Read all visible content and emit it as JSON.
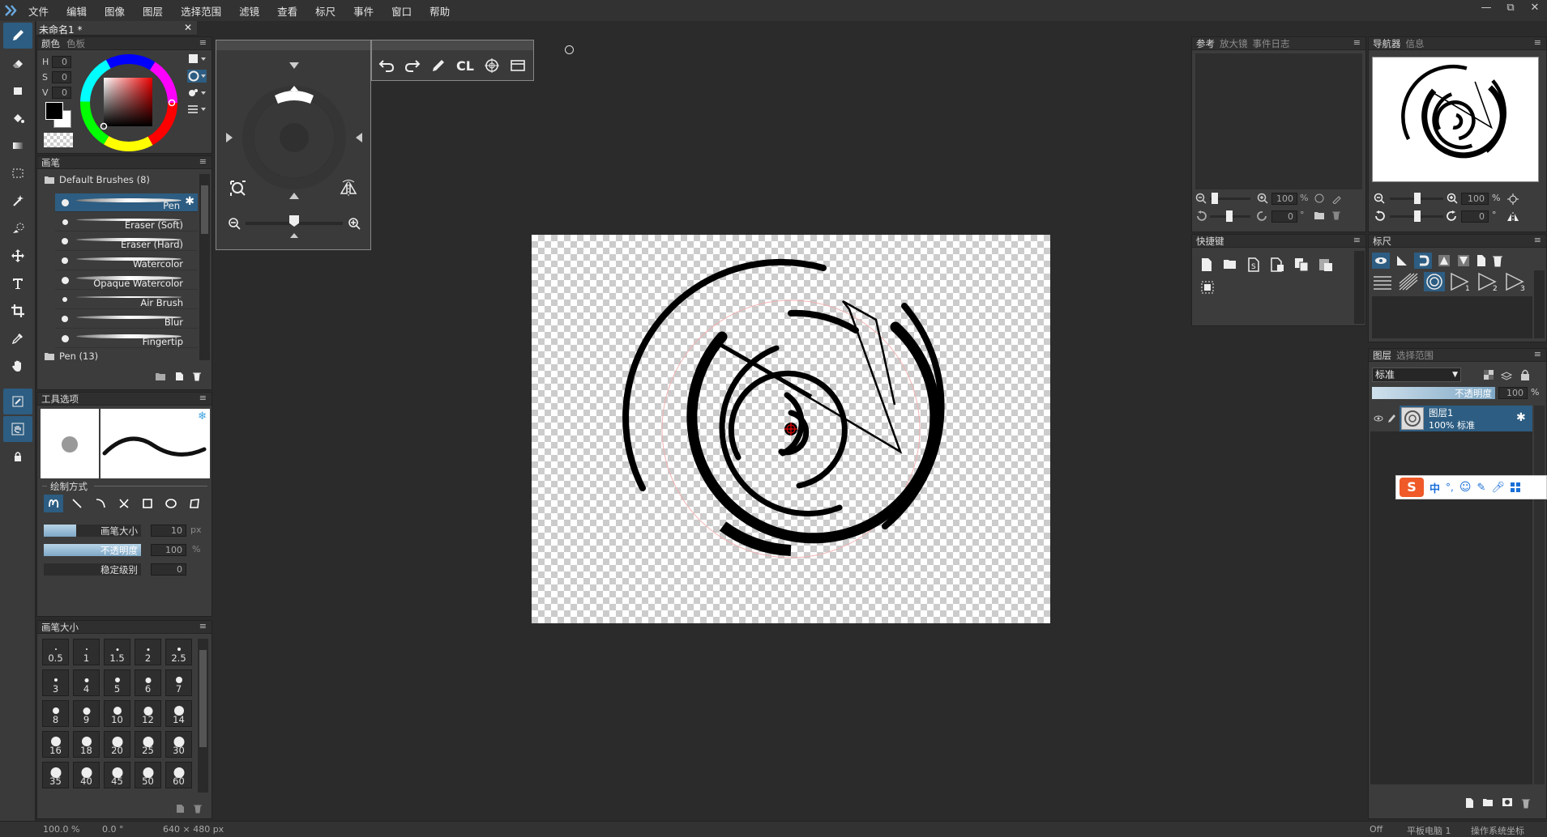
{
  "menu": [
    "文件",
    "编辑",
    "图像",
    "图层",
    "选择范围",
    "滤镜",
    "查看",
    "标尺",
    "事件",
    "窗口",
    "帮助"
  ],
  "window_controls": [
    "—",
    "⧉",
    "✕"
  ],
  "document_tab": {
    "title": "未命名1 *",
    "close": "✕"
  },
  "color_panel": {
    "tab_active": "颜色",
    "tab_inactive": "色板",
    "h_label": "H",
    "h_value": "0",
    "s_label": "S",
    "s_value": "0",
    "v_label": "V",
    "v_value": "0",
    "menu": "≡"
  },
  "brush_panel": {
    "title": "画笔",
    "group1": "Default Brushes (8)",
    "brushes": [
      "Pen",
      "Eraser (Soft)",
      "Eraser (Hard)",
      "Watercolor",
      "Opaque Watercolor",
      "Air Brush",
      "Blur",
      "Fingertip"
    ],
    "group2": "Pen (13)"
  },
  "tool_options": {
    "title": "工具选项",
    "draw_mode_label": "绘制方式",
    "brush_size_label": "画笔大小",
    "brush_size_value": "10",
    "brush_size_unit": "px",
    "opacity_label": "不透明度",
    "opacity_value": "100",
    "opacity_unit": "%",
    "stabilizer_label": "稳定级别",
    "stabilizer_value": "0"
  },
  "brush_size_panel": {
    "title": "画笔大小",
    "sizes": [
      "0.5",
      "1",
      "1.5",
      "2",
      "2.5",
      "3",
      "4",
      "5",
      "6",
      "7",
      "8",
      "9",
      "10",
      "12",
      "14",
      "16",
      "18",
      "20",
      "25",
      "30",
      "35",
      "40",
      "45",
      "50",
      "60"
    ]
  },
  "quick_toolbar": {
    "cl_label": "CL"
  },
  "reference_panel": {
    "tabs": [
      "参考",
      "放大镜",
      "事件日志"
    ],
    "zoom_value": "100",
    "zoom_unit": "%",
    "rotate_value": "0",
    "rotate_unit": "°"
  },
  "navigator_panel": {
    "tabs": [
      "导航器",
      "信息"
    ],
    "zoom_value": "100",
    "zoom_unit": "%",
    "rotate_value": "0",
    "rotate_unit": "°"
  },
  "shortcuts_panel": {
    "title": "快捷键"
  },
  "ruler_panel": {
    "title": "标尺"
  },
  "layers_panel": {
    "tabs": [
      "图层",
      "选择范围"
    ],
    "blend_mode": "标准",
    "opacity_label": "不透明度",
    "opacity_value": "100",
    "opacity_unit": "%",
    "layer_name": "图层1",
    "layer_info": "100% 标准"
  },
  "ime_toolbar": {
    "chinese": "中",
    "punct": "°,"
  },
  "status": {
    "zoom": "100.0 %",
    "rotation": "0.0 °",
    "canvas_size": "640 × 480 px",
    "off": "Off",
    "tablet": "平板电脑 1",
    "coord_mode": "操作系统坐标"
  },
  "colors": {
    "accent": "#2d5d82",
    "background": "#2b2b2b",
    "panel": "#3c3c3c"
  }
}
